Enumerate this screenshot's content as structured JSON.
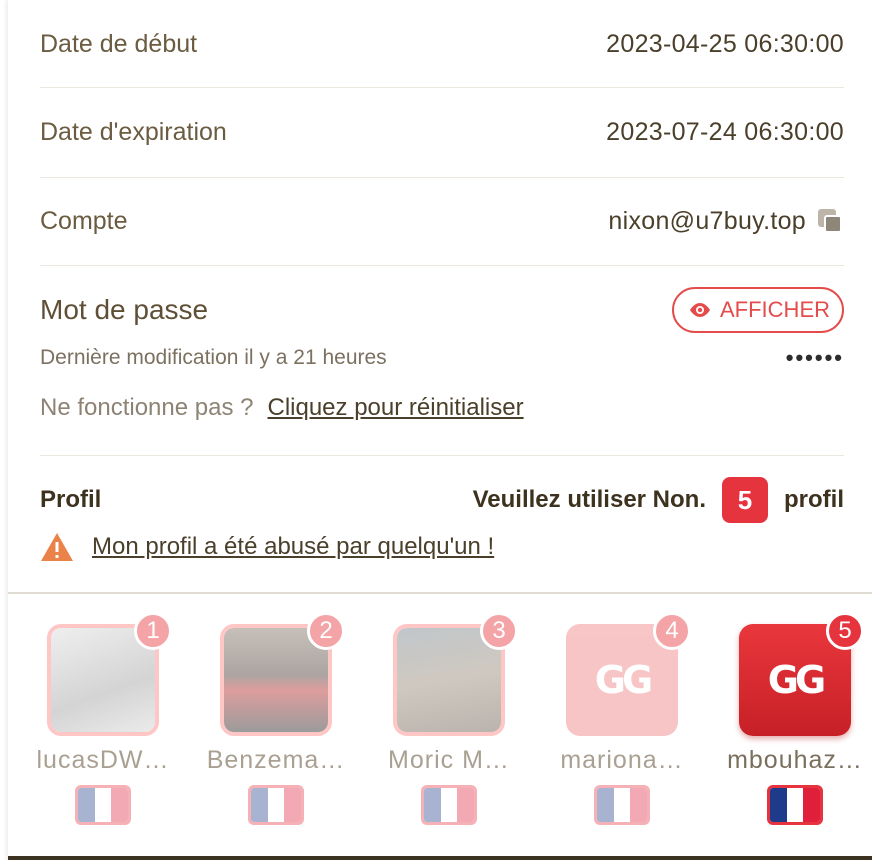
{
  "details": {
    "start": {
      "label": "Date de début",
      "value": "2023-04-25 06:30:00"
    },
    "expiry": {
      "label": "Date d'expiration",
      "value": "2023-07-24 06:30:00"
    },
    "account": {
      "label": "Compte",
      "value": "nixon@u7buy.top",
      "copy_icon": "copy-icon"
    }
  },
  "password": {
    "label": "Mot de passe",
    "show_label": "AFFICHER",
    "last_modified": "Dernière modification il y a 21 heures",
    "masked": "••••••",
    "not_working": "Ne fonctionne pas ?",
    "reset_link": "Cliquez pour réinitialiser"
  },
  "profile": {
    "label": "Profil",
    "use_prefix": "Veuillez utiliser Non.",
    "number": "5",
    "use_suffix": "profil",
    "abuse_link": "Mon profil a été abusé par quelqu'un !"
  },
  "profiles": [
    {
      "num": "1",
      "name": "lucasDW…",
      "active": false
    },
    {
      "num": "2",
      "name": "Benzema…",
      "active": false
    },
    {
      "num": "3",
      "name": "Moric M…",
      "active": false
    },
    {
      "num": "4",
      "name": "mariona…",
      "active": false,
      "avatar_text": "GG"
    },
    {
      "num": "5",
      "name": "mbouhaz…",
      "active": true,
      "avatar_text": "GG"
    }
  ],
  "colors": {
    "accent": "#e6343f",
    "text": "#4a3f2a"
  }
}
